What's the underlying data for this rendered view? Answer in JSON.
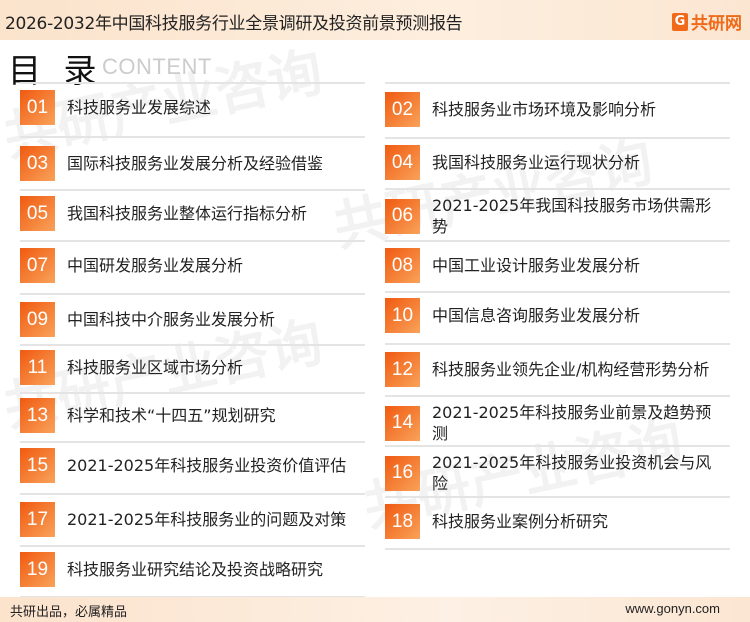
{
  "header": {
    "title": "2026-2032年中国科技服务行业全景调研及投资前景预测报告",
    "logo_text": "共研网",
    "logo_mark": "G"
  },
  "toc": {
    "heading": "目 录",
    "heading_en": "CONTENT"
  },
  "items": [
    {
      "num": "01",
      "label": "科技服务业发展综述"
    },
    {
      "num": "02",
      "label": "科技服务业市场环境及影响分析"
    },
    {
      "num": "03",
      "label": "国际科技服务业发展分析及经验借鉴"
    },
    {
      "num": "04",
      "label": "我国科技服务业运行现状分析"
    },
    {
      "num": "05",
      "label": "我国科技服务业整体运行指标分析"
    },
    {
      "num": "06",
      "label": "2021-2025年我国科技服务市场供需形势"
    },
    {
      "num": "07",
      "label": "中国研发服务业发展分析"
    },
    {
      "num": "08",
      "label": "中国工业设计服务业发展分析"
    },
    {
      "num": "09",
      "label": "中国科技中介服务业发展分析"
    },
    {
      "num": "10",
      "label": "中国信息咨询服务业发展分析"
    },
    {
      "num": "11",
      "label": "科技服务业区域市场分析"
    },
    {
      "num": "12",
      "label": "科技服务业领先企业/机构经营形势分析"
    },
    {
      "num": "13",
      "label": "科学和技术“十四五”规划研究"
    },
    {
      "num": "14",
      "label": "2021-2025年科技服务业前景及趋势预测"
    },
    {
      "num": "15",
      "label": "2021-2025年科技服务业投资价值评估"
    },
    {
      "num": "16",
      "label": "2021-2025年科技服务业投资机会与风险"
    },
    {
      "num": "17",
      "label": "2021-2025年科技服务业的问题及对策"
    },
    {
      "num": "18",
      "label": "科技服务业案例分析研究"
    },
    {
      "num": "19",
      "label": "科技服务业研究结论及投资战略研究"
    }
  ],
  "footer": {
    "slogan": "共研出品，必属精品",
    "url": "www.gonyn.com"
  },
  "watermark": "共研产业咨询",
  "colors": {
    "accent": "#f06a1a",
    "header_bg": "#fbe3cc"
  }
}
